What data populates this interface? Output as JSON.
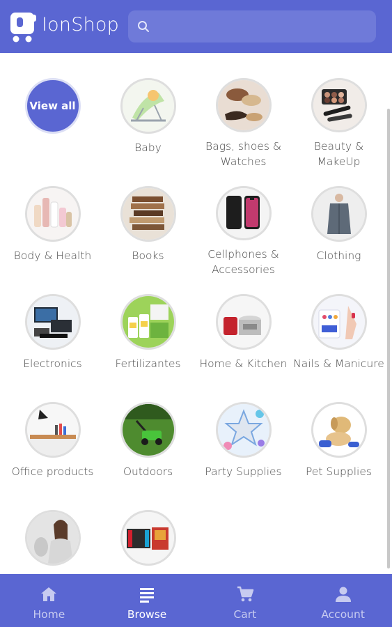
{
  "app": {
    "name": "IonShop"
  },
  "search": {
    "placeholder": ""
  },
  "categories": [
    {
      "label": "View all",
      "type": "viewall"
    },
    {
      "label": "Baby",
      "icon": "baby-bouncer-image"
    },
    {
      "label": "Bags, shoes & Watches",
      "icon": "bags-shoes-image"
    },
    {
      "label": "Beauty & MakeUp",
      "icon": "makeup-palette-image"
    },
    {
      "label": "Body & Health",
      "icon": "body-products-image"
    },
    {
      "label": "Books",
      "icon": "books-image"
    },
    {
      "label": "Cellphones & Accessories",
      "icon": "phones-image"
    },
    {
      "label": "Clothing",
      "icon": "coat-image"
    },
    {
      "label": "Electronics",
      "icon": "electronics-image"
    },
    {
      "label": "Fertilizantes",
      "icon": "fertilizer-image"
    },
    {
      "label": "Home & Kitchen",
      "icon": "kitchen-appliances-image"
    },
    {
      "label": "Nails & Manicure",
      "icon": "nail-polish-image"
    },
    {
      "label": "Office products",
      "icon": "office-desk-image"
    },
    {
      "label": "Outdoors",
      "icon": "lawnmower-image"
    },
    {
      "label": "Party Supplies",
      "icon": "party-balloons-image"
    },
    {
      "label": "Pet Supplies",
      "icon": "dog-image"
    },
    {
      "label": "",
      "icon": "woman-portrait-image"
    },
    {
      "label": "",
      "icon": "game-console-image"
    }
  ],
  "nav": [
    {
      "label": "Home",
      "icon": "home-icon"
    },
    {
      "label": "Browse",
      "icon": "browse-icon",
      "active": true
    },
    {
      "label": "Cart",
      "icon": "cart-icon"
    },
    {
      "label": "Account",
      "icon": "account-icon"
    }
  ],
  "colors": {
    "brand": "#5a66d2",
    "text": "#4a4a4a"
  }
}
